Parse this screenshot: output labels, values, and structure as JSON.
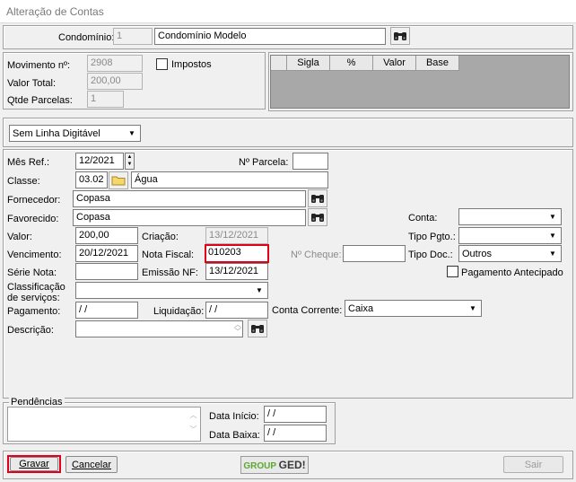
{
  "window": {
    "title": "Alteração de Contas"
  },
  "condominio": {
    "label": "Condomínio:",
    "code": "1",
    "name": "Condomínio Modelo"
  },
  "movimento": {
    "numero_label": "Movimento nº:",
    "numero": "2908",
    "impostos_label": "Impostos",
    "valor_total_label": "Valor Total:",
    "valor_total": "200,00",
    "parcelas_label": "Qtde Parcelas:",
    "parcelas": "1"
  },
  "impostos_grid": {
    "columns": [
      "Sigla",
      "%",
      "Valor",
      "Base"
    ]
  },
  "linha_digitavel": {
    "selected": "Sem Linha Digitável"
  },
  "form": {
    "mes_ref_label": "Mês Ref.:",
    "mes_ref": "12/2021",
    "parcela_label": "Nº Parcela:",
    "parcela": "",
    "classe_label": "Classe:",
    "classe_code": "03.02",
    "classe_name": "Água",
    "fornecedor_label": "Fornecedor:",
    "fornecedor": "Copasa",
    "favorecido_label": "Favorecido:",
    "favorecido": "Copasa",
    "conta_label": "Conta:",
    "conta": "",
    "valor_label": "Valor:",
    "valor": "200,00",
    "criacao_label": "Criação:",
    "criacao": "13/12/2021",
    "tipo_pgto_label": "Tipo Pgto.:",
    "tipo_pgto": "",
    "vencimento_label": "Vencimento:",
    "vencimento": "20/12/2021",
    "nota_fiscal_label": "Nota Fiscal:",
    "nota_fiscal": "010203",
    "cheque_label": "Nº Cheque:",
    "cheque": "",
    "tipo_doc_label": "Tipo Doc.:",
    "tipo_doc": "Outros",
    "serie_label": "Série Nota:",
    "serie": "",
    "emissao_label": "Emissão NF:",
    "emissao": "13/12/2021",
    "pagamento_antecipado_label": "Pagamento Antecipado",
    "classificacao_label_1": "Classificação",
    "classificacao_label_2": "de serviços:",
    "classificacao": "",
    "pagamento_label": "Pagamento:",
    "pagamento": " / /",
    "liquidacao_label": "Liquidação:",
    "liquidacao": " / /",
    "conta_corrente_label": "Conta Corrente:",
    "conta_corrente": "Caixa",
    "descricao_label": "Descrição:",
    "descricao": ""
  },
  "pendencias": {
    "legend": "Pendências",
    "data_inicio_label": "Data Início:",
    "data_inicio": " / /",
    "data_baixa_label": "Data Baixa:",
    "data_baixa": " / /"
  },
  "footer": {
    "gravar": "Gravar",
    "cancelar": "Cancelar",
    "sair": "Sair",
    "logo_group": "GROUP",
    "logo_ged": "GED!"
  },
  "colors": {
    "highlight": "#e0001a",
    "logo_green": "#5aa832"
  }
}
